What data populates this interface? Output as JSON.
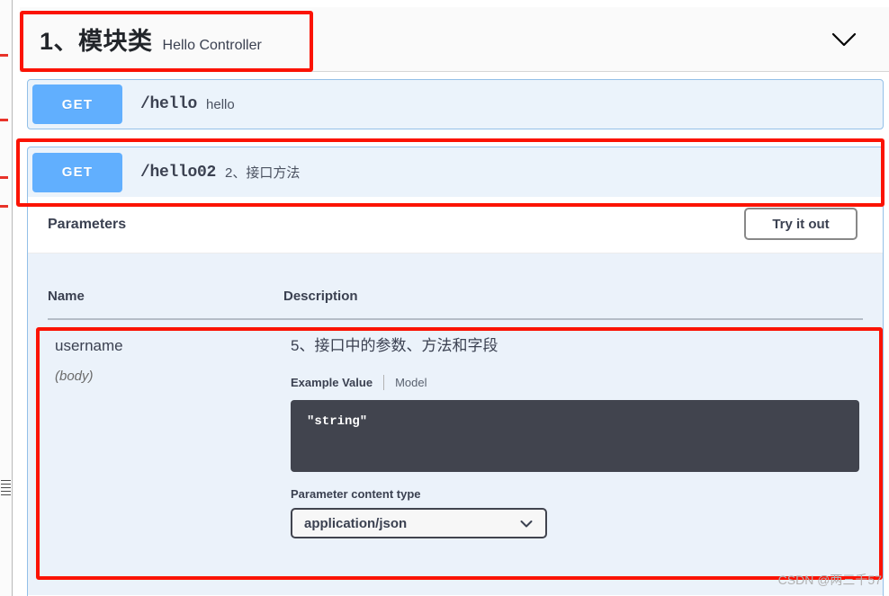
{
  "gutter": {
    "tick_marks": [
      "tick",
      "tick",
      "tick",
      "tick"
    ]
  },
  "tag": {
    "title": "1、模块类",
    "description": "Hello Controller",
    "chevron_icon": "chevron-down-icon"
  },
  "operations": [
    {
      "method": "GET",
      "path": "/hello",
      "summary": "hello"
    },
    {
      "method": "GET",
      "path": "/hello02",
      "summary": "2、接口方法"
    }
  ],
  "parameters_section": {
    "heading": "Parameters",
    "try_it_out_label": "Try it out",
    "columns": {
      "name": "Name",
      "description": "Description"
    },
    "rows": [
      {
        "name": "username",
        "in": "(body)",
        "description": "5、接口中的参数、方法和字段",
        "example_tab_label": "Example Value",
        "model_tab_label": "Model",
        "example_code": "\"string\"",
        "content_type_label": "Parameter content type",
        "content_type_value": "application/json",
        "content_type_chevron": "chevron-down-icon"
      }
    ]
  },
  "colors": {
    "get_method": "#61affe",
    "opblock_bg": "#ebf3fb",
    "opblock_border": "#93c0e8",
    "code_bg": "#41444e",
    "annotation_red": "#fb1304",
    "table_bg": "#ebf2fa"
  },
  "watermark": {
    "text": "CSDN @两三千57"
  }
}
